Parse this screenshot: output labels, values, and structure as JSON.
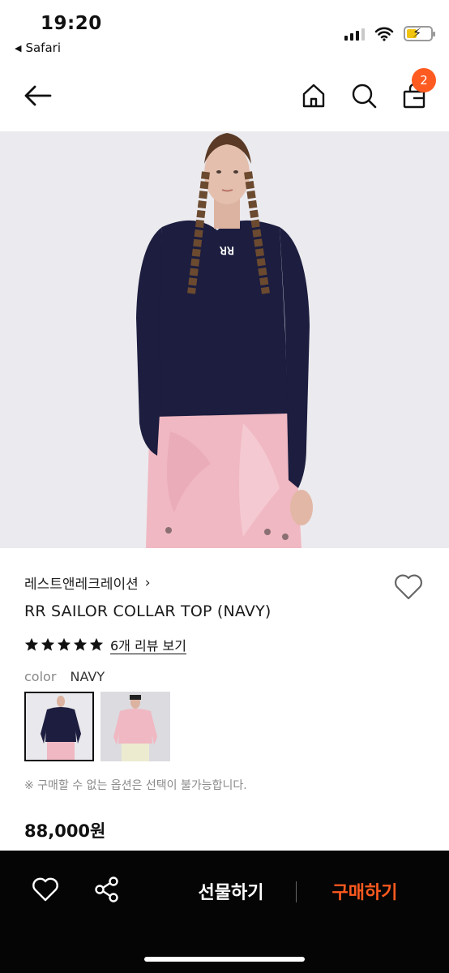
{
  "status_bar": {
    "time": "19:20",
    "back_app": "Safari",
    "icons": [
      "signal-icon",
      "wifi-icon",
      "battery-charging-icon"
    ]
  },
  "nav": {
    "back_icon": "arrow-left-icon",
    "home_icon": "home-icon",
    "search_icon": "search-icon",
    "cart_icon": "shopping-bag-icon",
    "cart_count": "2"
  },
  "product": {
    "brand": "레스트앤레크레이션",
    "brand_chevron": "›",
    "name": "RR SAILOR COLLAR TOP (NAVY)",
    "rating_stars": 5,
    "review_link": "6개 리뷰 보기",
    "color_label": "color",
    "color_value": "NAVY",
    "options": [
      "navy",
      "pink"
    ],
    "notice": "※ 구매할 수 없는 옵션은 선택이 불가능합니다.",
    "price": "88,000원"
  },
  "bottom_bar": {
    "wishlist_icon": "heart-icon",
    "share_icon": "share-icon",
    "gift_label": "선물하기",
    "buy_label": "구매하기"
  },
  "colors": {
    "accent": "#ff5a1f",
    "bottom_bar_bg": "#050505",
    "navy": "#1c1d3f",
    "pink": "#f0b8c2"
  }
}
